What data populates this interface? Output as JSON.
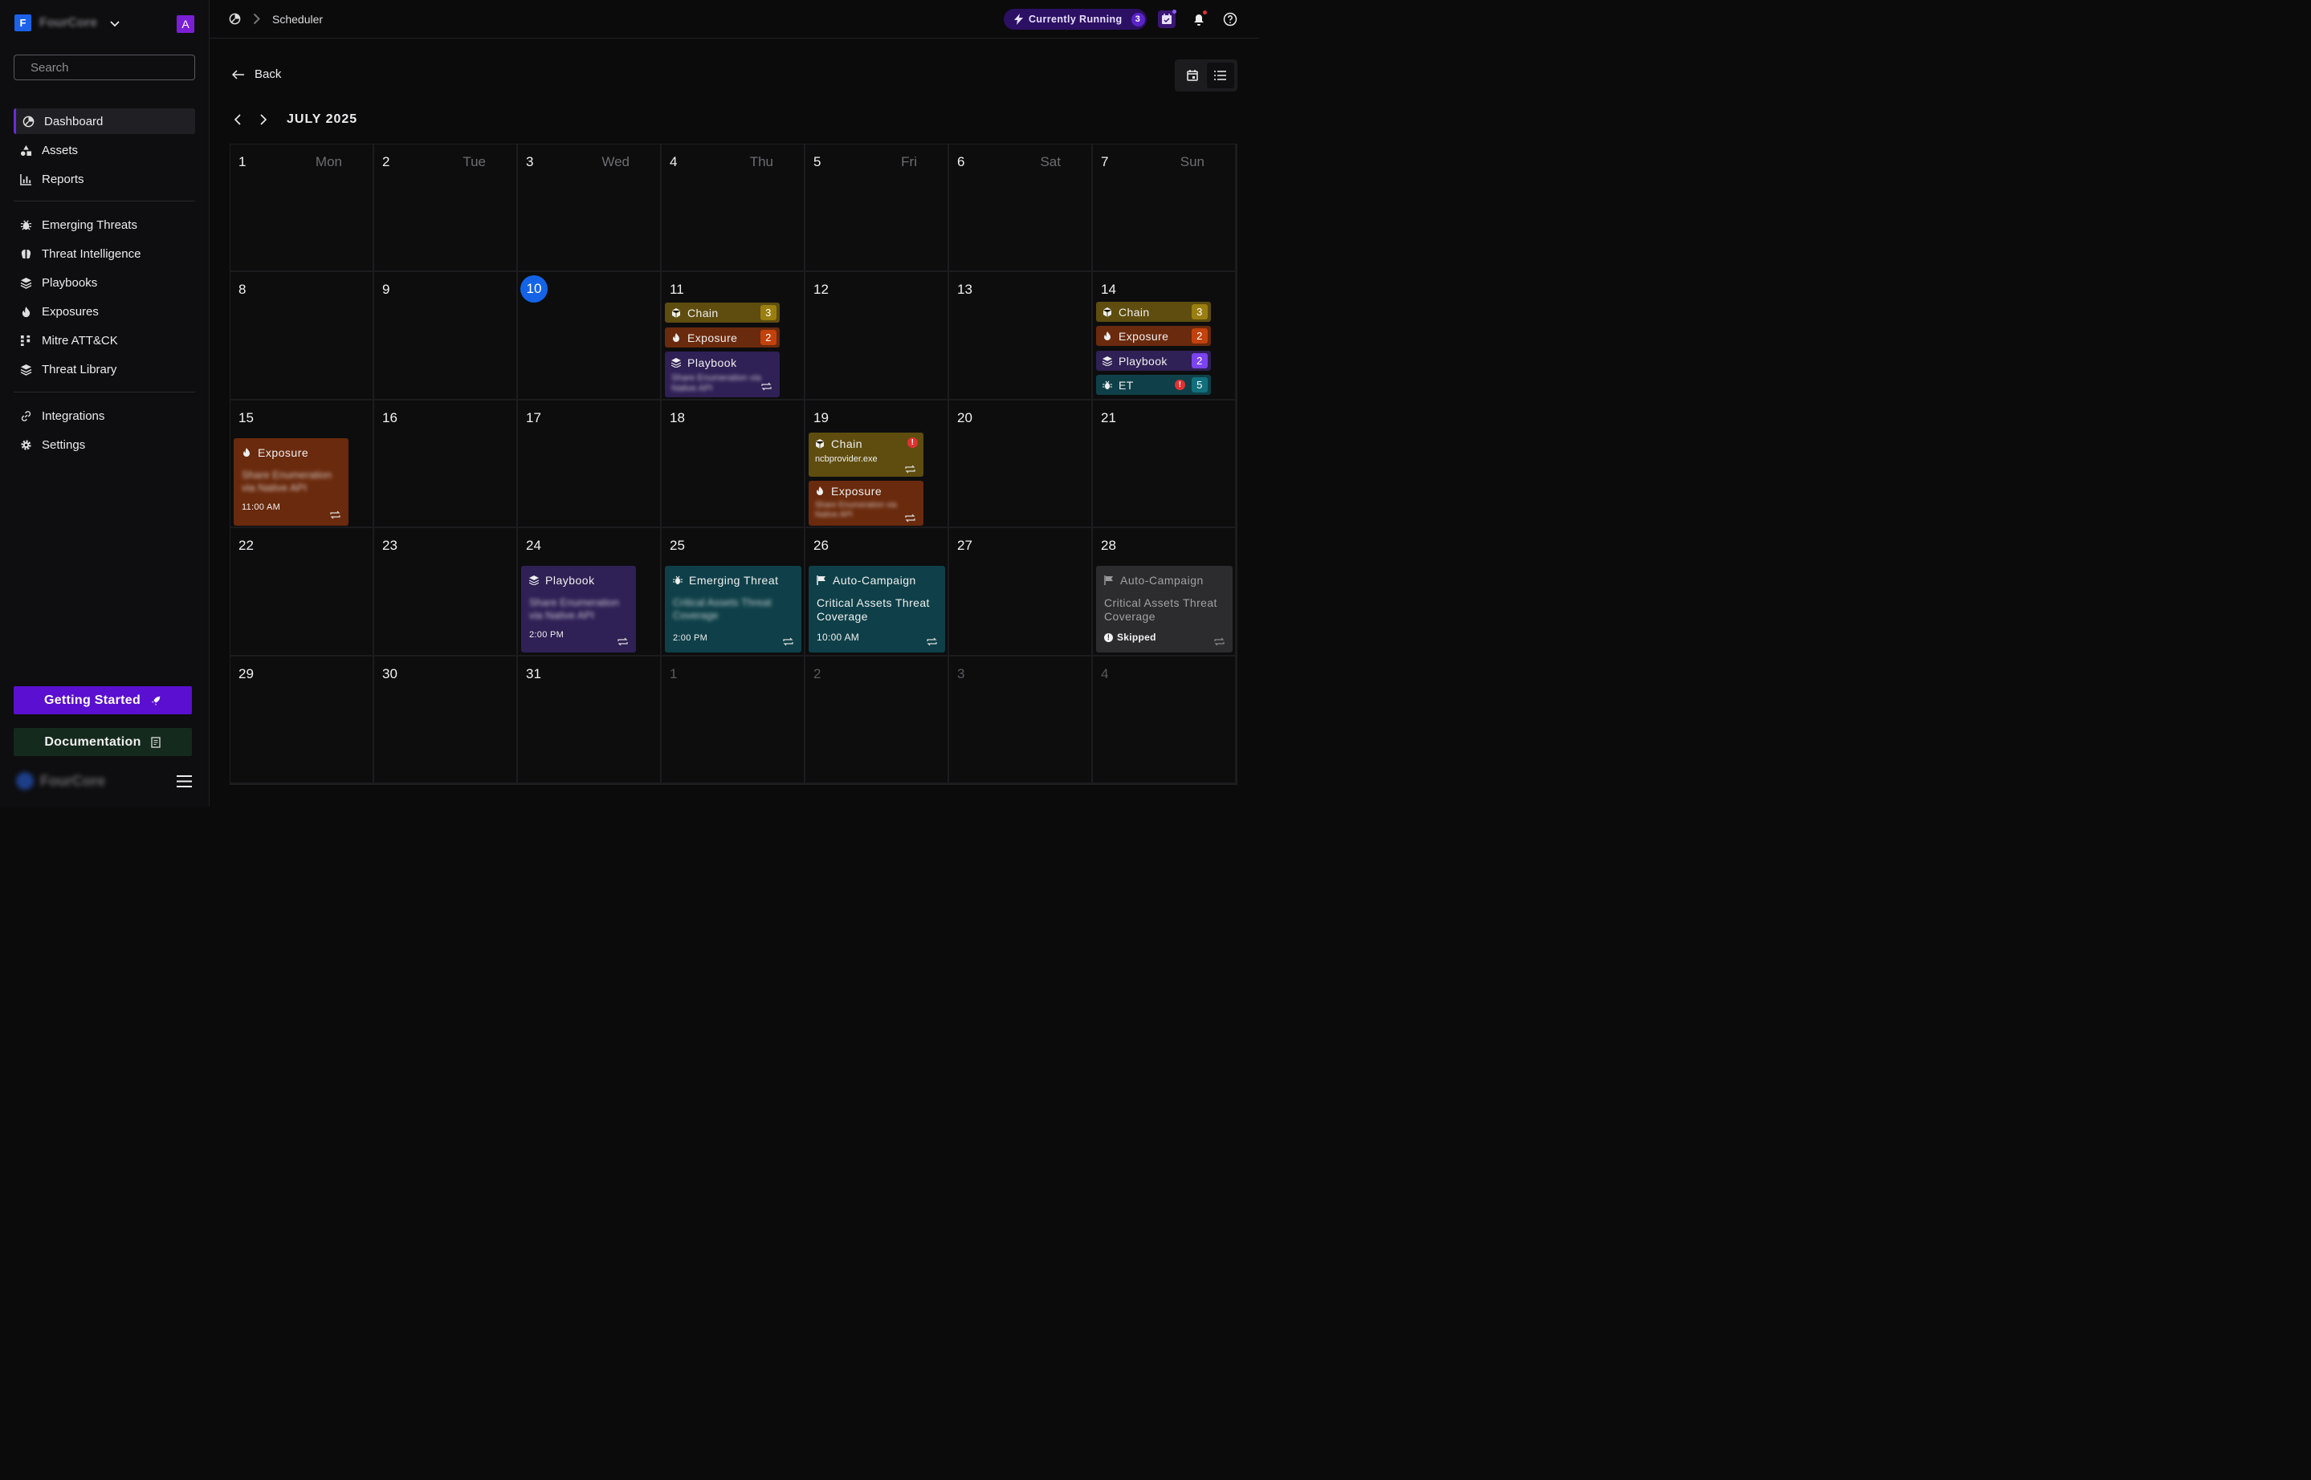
{
  "org": {
    "logo_letter": "F",
    "name": "FourCore",
    "avatar_letter": "A"
  },
  "search": {
    "placeholder": "Search"
  },
  "sidebar": {
    "primary": [
      {
        "label": "Dashboard",
        "icon": "pie-chart-icon",
        "active": true
      },
      {
        "label": "Assets",
        "icon": "shapes-icon"
      },
      {
        "label": "Reports",
        "icon": "bar-chart-icon"
      }
    ],
    "threats": [
      {
        "label": "Emerging Threats",
        "icon": "bug-icon"
      },
      {
        "label": "Threat Intelligence",
        "icon": "brain-icon"
      },
      {
        "label": "Playbooks",
        "icon": "layers-icon"
      },
      {
        "label": "Exposures",
        "icon": "flame-icon"
      },
      {
        "label": "Mitre ATT&CK",
        "icon": "matrix-icon"
      },
      {
        "label": "Threat Library",
        "icon": "layers-icon"
      }
    ],
    "settings": [
      {
        "label": "Integrations",
        "icon": "link-icon"
      },
      {
        "label": "Settings",
        "icon": "gear-icon"
      }
    ],
    "getting_started": "Getting Started",
    "documentation": "Documentation",
    "footer_brand": "FourCore"
  },
  "header": {
    "breadcrumb": "Scheduler",
    "running_label": "Currently Running",
    "running_count": "3"
  },
  "page": {
    "back_label": "Back",
    "month_label": "JULY 2025"
  },
  "calendar": {
    "weekdays": [
      "Mon",
      "Tue",
      "Wed",
      "Thu",
      "Fri",
      "Sat",
      "Sun"
    ],
    "days": [
      "1",
      "2",
      "3",
      "4",
      "5",
      "6",
      "7",
      "8",
      "9",
      "10",
      "11",
      "12",
      "13",
      "14",
      "15",
      "16",
      "17",
      "18",
      "19",
      "20",
      "21",
      "22",
      "23",
      "24",
      "25",
      "26",
      "27",
      "28",
      "29",
      "30",
      "31",
      "1",
      "2",
      "3",
      "4"
    ],
    "today": "10",
    "events": {
      "d11": {
        "chain": {
          "label": "Chain",
          "count": "3"
        },
        "exposure": {
          "label": "Exposure",
          "count": "2"
        },
        "playbook": {
          "label": "Playbook",
          "detail": "Share Enumeration via Native API"
        }
      },
      "d14": {
        "chain": {
          "label": "Chain",
          "count": "3"
        },
        "exposure": {
          "label": "Exposure",
          "count": "2"
        },
        "playbook": {
          "label": "Playbook",
          "count": "2"
        },
        "et": {
          "label": "ET",
          "count": "5",
          "alert": "!"
        }
      },
      "d15": {
        "label": "Exposure",
        "detail": "Share Enumeration via Native API",
        "time": "11:00 AM"
      },
      "d19": {
        "chain": {
          "label": "Chain",
          "detail": "ncbprovider.exe",
          "alert": "!"
        },
        "exposure": {
          "label": "Exposure",
          "detail": "Share Enumeration via Native API"
        }
      },
      "d24": {
        "label": "Playbook",
        "detail": "Share Enumeration via Native API",
        "time": "2:00 PM"
      },
      "d25": {
        "label": "Emerging Threat",
        "detail": "Critical Assets Threat Coverage",
        "time": "2:00 PM"
      },
      "d26": {
        "label": "Auto-Campaign",
        "detail": "Critical Assets Threat Coverage",
        "time": "10:00 AM"
      },
      "d28": {
        "label": "Auto-Campaign",
        "detail": "Critical Assets Threat Coverage",
        "status": "Skipped",
        "status_icon": "!"
      }
    }
  },
  "colors": {
    "accent": "#5a0fd1",
    "today": "#1463e6",
    "chain": "#5e4d0f",
    "exposure": "#6a2a0d",
    "playbook": "#2f2055",
    "emerging": "#0f4049"
  }
}
